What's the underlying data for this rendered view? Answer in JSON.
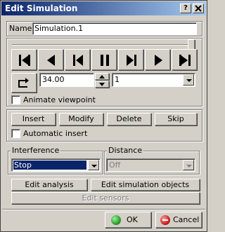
{
  "window": {
    "title": "Edit Simulation",
    "help_glyph": "?",
    "close_glyph": "x"
  },
  "name_field": {
    "label": "Name:",
    "value": "Simulation.1"
  },
  "player": {
    "slider_position": 1.0,
    "buttons": [
      "jump-to-start",
      "step-backward",
      "play-backward",
      "pause",
      "play-forward",
      "step-forward",
      "jump-to-end"
    ],
    "step_value": "34.00",
    "sample_value": "1",
    "animate_viewpoint_label": "Animate viewpoint",
    "animate_viewpoint_checked": false
  },
  "edit_buttons": {
    "insert": "Insert",
    "modify": "Modify",
    "delete": "Delete",
    "skip": "Skip",
    "automatic_insert_label": "Automatic insert",
    "automatic_insert_checked": false
  },
  "interference": {
    "label": "Interference",
    "value": "Stop"
  },
  "distance": {
    "label": "Distance",
    "value": "Off",
    "enabled": false
  },
  "actions": {
    "edit_analysis": "Edit analysis",
    "edit_simulation_objects": "Edit simulation objects",
    "edit_sensors": "Edit sensors"
  },
  "footer": {
    "ok": "OK",
    "cancel": "Cancel"
  },
  "colors": {
    "title_start": "#0a246a",
    "title_end": "#a6caf0",
    "selection": "#0a246a",
    "ok_icon": "#2ea02e",
    "cancel_icon": "#d02020"
  }
}
